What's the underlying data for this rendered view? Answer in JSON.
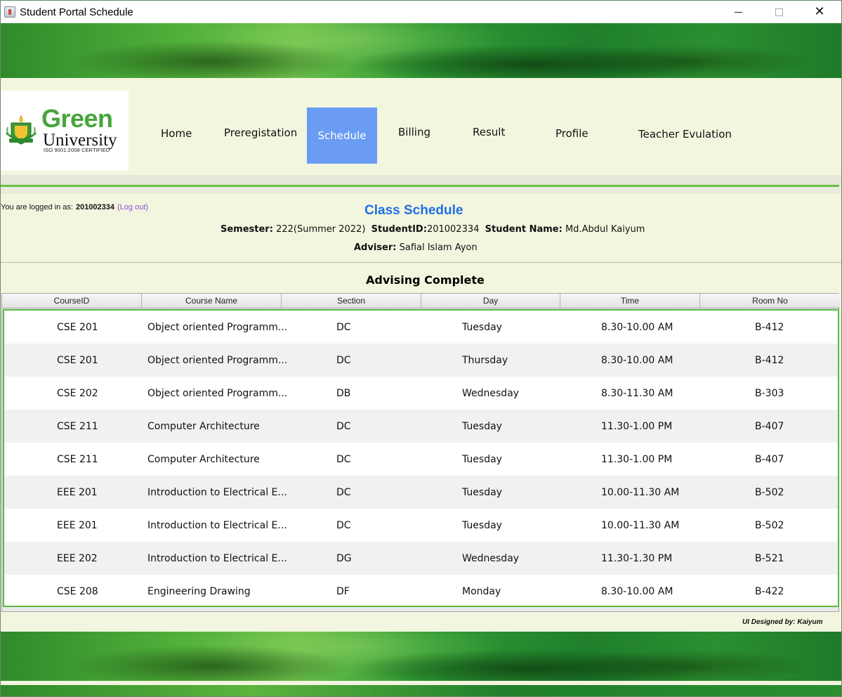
{
  "window": {
    "title": "Student Portal Schedule"
  },
  "logo": {
    "name_top": "Green",
    "name_bottom": "University",
    "certification": "ISO 9001:2008 CERTIFIED",
    "emblem_text": "Green University"
  },
  "nav": {
    "items": [
      {
        "label": "Home"
      },
      {
        "label": "Preregistation"
      },
      {
        "label": "Schedule",
        "active": true
      },
      {
        "label": "Billing"
      },
      {
        "label": "Result"
      },
      {
        "label": "Profile"
      },
      {
        "label": "Teacher Evulation"
      }
    ],
    "active_color": "#6a9cf4"
  },
  "session": {
    "logged_in_label": "You are logged in as:",
    "user_id": "201002334",
    "logout_label": "(Log out)"
  },
  "header": {
    "title": "Class Schedule",
    "semester_label": "Semester:",
    "semester_value": "222(Summer 2022)",
    "student_id_label": "StudentID:",
    "student_id_value": "201002334",
    "student_name_label": "Student Name:",
    "student_name_value": "Md.Abdul Kaiyum",
    "adviser_label": "Adviser:",
    "adviser_value": "Safial Islam Ayon"
  },
  "status": {
    "text": "Advising Complete"
  },
  "table": {
    "columns": [
      "CourseID",
      "Course Name",
      "Section",
      "Day",
      "Time",
      "Room No"
    ],
    "rows": [
      [
        "CSE 201",
        "Object oriented Programm...",
        "DC",
        "Tuesday",
        "8.30-10.00 AM",
        "B-412"
      ],
      [
        "CSE 201",
        "Object oriented Programm...",
        "DC",
        "Thursday",
        "8.30-10.00 AM",
        "B-412"
      ],
      [
        "CSE 202",
        "Object oriented Programm...",
        "DB",
        "Wednesday",
        "8.30-11.30 AM",
        "B-303"
      ],
      [
        "CSE 211",
        "Computer Architecture",
        "DC",
        "Tuesday",
        "11.30-1.00 PM",
        "B-407"
      ],
      [
        "CSE 211",
        "Computer Architecture",
        "DC",
        "Tuesday",
        "11.30-1.00 PM",
        "B-407"
      ],
      [
        "EEE 201",
        "Introduction to Electrical E...",
        "DC",
        "Tuesday",
        "10.00-11.30 AM",
        "B-502"
      ],
      [
        "EEE 201",
        "Introduction to Electrical E...",
        "DC",
        "Tuesday",
        "10.00-11.30 AM",
        "B-502"
      ],
      [
        "EEE 202",
        "Introduction to Electrical E...",
        "DG",
        "Wednesday",
        "11.30-1.30 PM",
        "B-521"
      ],
      [
        "CSE 208",
        "Engineering Drawing",
        "DF",
        "Monday",
        "8.30-10.00 AM",
        "B-422"
      ]
    ]
  },
  "footer": {
    "credit": "UI Designed by: Kaiyum"
  },
  "colors": {
    "accent_blue": "#1f6fe6",
    "brand_green": "#46a63a",
    "table_border_green": "#5cb944",
    "page_background": "#f3f6df"
  }
}
